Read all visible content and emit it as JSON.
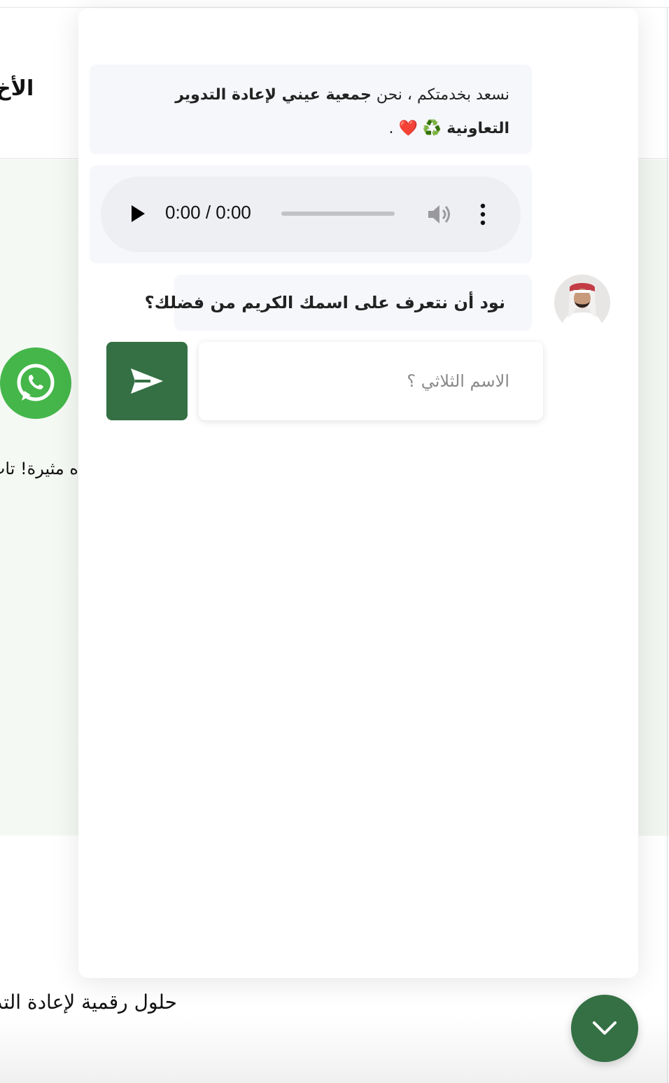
{
  "background": {
    "header_title": "الأخ",
    "whatsapp_icon": "whatsapp-icon",
    "promo_text": "ه مثيرة! تاب اليوم",
    "footer_text": "حلول رقمية لإعادة التدوير"
  },
  "chat": {
    "welcome": {
      "intro": "نسعد بخدمتكم ، نحن",
      "org_name": "جمعية عيني لإعادة التدوير التعاونية",
      "emoji": "♻️ ❤️ ."
    },
    "audio": {
      "time": "0:00 / 0:00",
      "icons": [
        "play-icon",
        "volume-icon",
        "more-options-icon"
      ]
    },
    "agent_avatar": "agent-avatar",
    "question": "نود أن نتعرف على اسمك الكريم من فضلك؟",
    "input": {
      "placeholder": "الاسم الثلاثي ؟",
      "value": ""
    },
    "send_icon": "send-icon",
    "collapse_icon": "chevron-down-icon"
  },
  "colors": {
    "brand_green": "#347044",
    "whatsapp_green": "#45b64a",
    "bubble_bg": "#f6f7fb"
  }
}
